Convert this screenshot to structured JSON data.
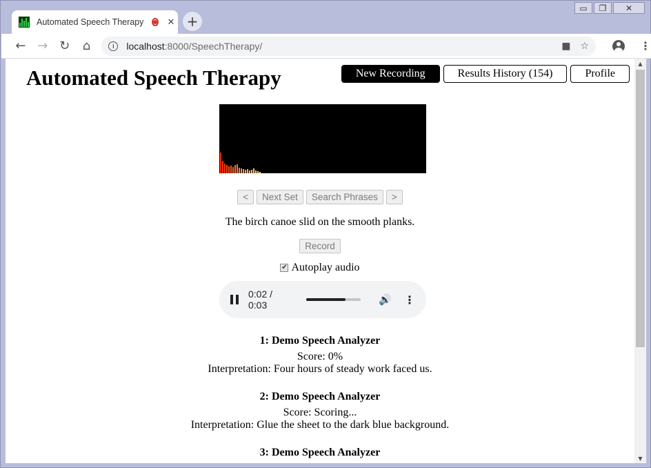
{
  "window": {
    "minimize": "▭",
    "restore": "❐",
    "close": "✕"
  },
  "tab": {
    "title": "Automated Speech Therapy",
    "recording_indicator": "record-dot-icon",
    "close": "✕"
  },
  "toolbar": {
    "back": "←",
    "forward": "→",
    "reload": "↻",
    "home": "⌂",
    "url_host": "localhost",
    "url_rest": ":8000/SpeechTherapy/",
    "new_tab": "+"
  },
  "app": {
    "title": "Automated Speech Therapy",
    "nav": {
      "new_recording": "New Recording",
      "results_history": "Results History (154)",
      "profile": "Profile"
    }
  },
  "visualizer": {
    "bars": [
      0.3,
      0.18,
      0.14,
      0.12,
      0.1,
      0.11,
      0.09,
      0.12,
      0.13,
      0.08,
      0.07,
      0.06,
      0.05,
      0.06,
      0.04,
      0.05,
      0.07,
      0.04,
      0.03,
      0.02
    ]
  },
  "controls": {
    "prev": "<",
    "next_set": "Next Set",
    "search_phrases": "Search Phrases",
    "next": ">"
  },
  "phrase": "The birch canoe slid on the smooth planks.",
  "record_label": "Record",
  "autoplay": {
    "label": "Autoplay audio",
    "checked": true
  },
  "audio": {
    "time": "0:02 / 0:03",
    "progress": 0.72
  },
  "results": [
    {
      "title": "1: Demo Speech Analyzer",
      "score": "Score: 0%",
      "interpretation": "Interpretation: Four hours of steady work faced us."
    },
    {
      "title": "2: Demo Speech Analyzer",
      "score": "Score: Scoring...",
      "interpretation": "Interpretation: Glue the sheet to the dark blue background."
    },
    {
      "title": "3: Demo Speech Analyzer",
      "score": "",
      "interpretation": ""
    }
  ]
}
